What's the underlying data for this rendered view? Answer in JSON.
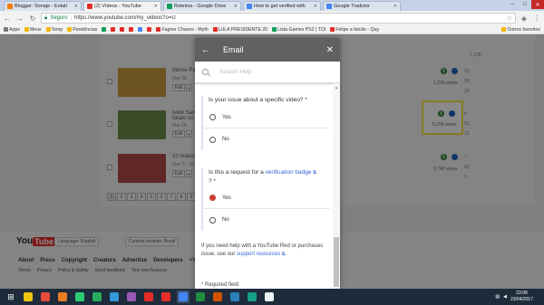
{
  "browser": {
    "tabs": [
      {
        "title": "Blogger: Sonaje - Estatí",
        "color": "#f57c00"
      },
      {
        "title": "(2) Vídeos - YouTube",
        "color": "#e52d27"
      },
      {
        "title": "Roteiros - Google Drive",
        "color": "#0f9d58"
      },
      {
        "title": "How to get verified with",
        "color": "#4285f4"
      },
      {
        "title": "Google Tradutor",
        "color": "#4285f4"
      }
    ],
    "secure_label": "Seguro",
    "url": "https://www.youtube.com/my_videos?o=U",
    "bookmarks": [
      {
        "label": "Apps",
        "color": "#777"
      },
      {
        "label": "Meus",
        "color": "#f2b600"
      },
      {
        "label": "Temp",
        "color": "#f2b600"
      },
      {
        "label": "Pendências",
        "color": "#f2b600"
      },
      {
        "label": "",
        "color": "#0f9d58"
      },
      {
        "label": "",
        "color": "#e52d27"
      },
      {
        "label": "",
        "color": "#e52d27"
      },
      {
        "label": "",
        "color": "#e52d27"
      },
      {
        "label": "",
        "color": "#4285f4"
      },
      {
        "label": "",
        "color": "#e52d27"
      },
      {
        "label": "Fagner Chaves - Myth",
        "color": "#e52d27"
      },
      {
        "label": "LULA PRESIDENTE 20",
        "color": "#e52d27"
      },
      {
        "label": "Lista Games PS2 | TOI",
        "color": "#0f9d58"
      },
      {
        "label": "Felipe a falcão - Quy",
        "color": "#e52d27"
      }
    ],
    "bookmarks_right": "Outros favoritos"
  },
  "page": {
    "top_views": "1,198",
    "videos": [
      {
        "title": "Meme Pa",
        "date": "Mar 28,",
        "views": "1,339 views",
        "stats": [
          "32",
          "98",
          "28"
        ],
        "thumb": "#c89a3c"
      },
      {
        "title": "Ivete Sang",
        "title2": "foram no",
        "date": "Mar 28,",
        "views": "6,299 views",
        "stats": [
          "4",
          "63",
          "15"
        ],
        "thumb": "#6a8a4a"
      },
      {
        "title": "10 maiore",
        "date": "Mar 27, 20",
        "views": "2,740 views",
        "stats": [
          "7",
          "83",
          "9"
        ],
        "thumb": "#b04848"
      }
    ],
    "edit_label": "Edit",
    "pages": [
      "1",
      "2",
      "3",
      "4",
      "5",
      "6",
      "7",
      "8",
      "9",
      "10",
      "11"
    ],
    "footer": {
      "logo_you": "You",
      "logo_tube": "Tube",
      "language": "Language: English",
      "location": "Content location: Brazil",
      "links": [
        "About",
        "Press",
        "Copyright",
        "Creators",
        "Advertise",
        "Developers",
        "+YouTu"
      ],
      "links2": [
        "Terms",
        "Privacy",
        "Policy & Safety",
        "Send feedback",
        "Test new features"
      ]
    }
  },
  "dialog": {
    "title": "Email",
    "search_placeholder": "Search Help",
    "q1": "Is your issue about a specific video? *",
    "q1_options": [
      "Yes",
      "No"
    ],
    "q2_prefix": "Is this a request for a",
    "q2_link": "verification badge",
    "q2_suffix": "? *",
    "q2_options": [
      "Yes",
      "No"
    ],
    "q2_selected": "Yes",
    "help_text": "If you need help with a YouTube Red or purchases issue, use our",
    "help_link": "support resources",
    "required": "* Required field"
  },
  "taskbar": {
    "time": "23:08",
    "date": "23/04/2017",
    "apps": [
      "#f1c40f",
      "#e74c3c",
      "#e67e22",
      "#2ecc71",
      "#27ae60",
      "#3498db",
      "#9b59b6",
      "#e52d27",
      "#e52d27",
      "#4285f4",
      "#1e8e3e",
      "#d35400",
      "#2980b9",
      "#16a085",
      "#ecf0f1"
    ],
    "active_index": 9
  }
}
